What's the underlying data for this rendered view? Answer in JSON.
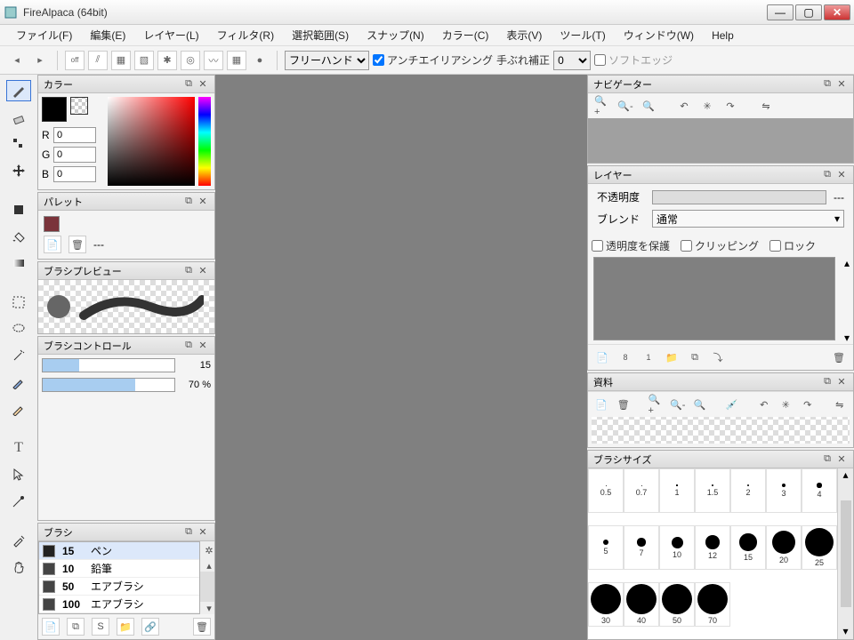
{
  "app": {
    "title": "FireAlpaca (64bit)"
  },
  "menu": [
    "ファイル(F)",
    "編集(E)",
    "レイヤー(L)",
    "フィルタ(R)",
    "選択範囲(S)",
    "スナップ(N)",
    "カラー(C)",
    "表示(V)",
    "ツール(T)",
    "ウィンドウ(W)",
    "Help"
  ],
  "toolbar": {
    "mode_select": "フリーハンド",
    "aa_label": "アンチエイリアシング",
    "stab_label": "手ぶれ補正",
    "stab_value": "0",
    "soft_label": "ソフトエッジ"
  },
  "panels": {
    "color": {
      "title": "カラー",
      "r": "0",
      "g": "0",
      "b": "0",
      "r_lbl": "R",
      "g_lbl": "G",
      "b_lbl": "B"
    },
    "palette": {
      "title": "パレット",
      "dash": "---"
    },
    "brush_preview": {
      "title": "ブラシプレビュー"
    },
    "brush_control": {
      "title": "ブラシコントロール",
      "size": "15",
      "opacity": "70 %"
    },
    "brush": {
      "title": "ブラシ",
      "items": [
        {
          "size": "15",
          "name": "ペン"
        },
        {
          "size": "10",
          "name": "鉛筆"
        },
        {
          "size": "50",
          "name": "エアブラシ"
        },
        {
          "size": "100",
          "name": "エアブラシ"
        }
      ]
    },
    "navigator": {
      "title": "ナビゲーター"
    },
    "layer": {
      "title": "レイヤー",
      "opacity_lbl": "不透明度",
      "dash": "---",
      "blend_lbl": "ブレンド",
      "blend_val": "通常",
      "protect": "透明度を保護",
      "clipping": "クリッピング",
      "lock": "ロック"
    },
    "reference": {
      "title": "資料"
    },
    "brush_size": {
      "title": "ブラシサイズ",
      "sizes": [
        0.5,
        0.7,
        1,
        1.5,
        2,
        3,
        4,
        5,
        7,
        10,
        12,
        15,
        20,
        25,
        30,
        40,
        50,
        70
      ],
      "labels": [
        "0.5",
        "0.7",
        "1",
        "1.5",
        "2",
        "3",
        "4",
        "5",
        "7",
        "10",
        "12",
        "15",
        "20",
        "25",
        "30",
        "40",
        "50",
        "70"
      ]
    }
  }
}
